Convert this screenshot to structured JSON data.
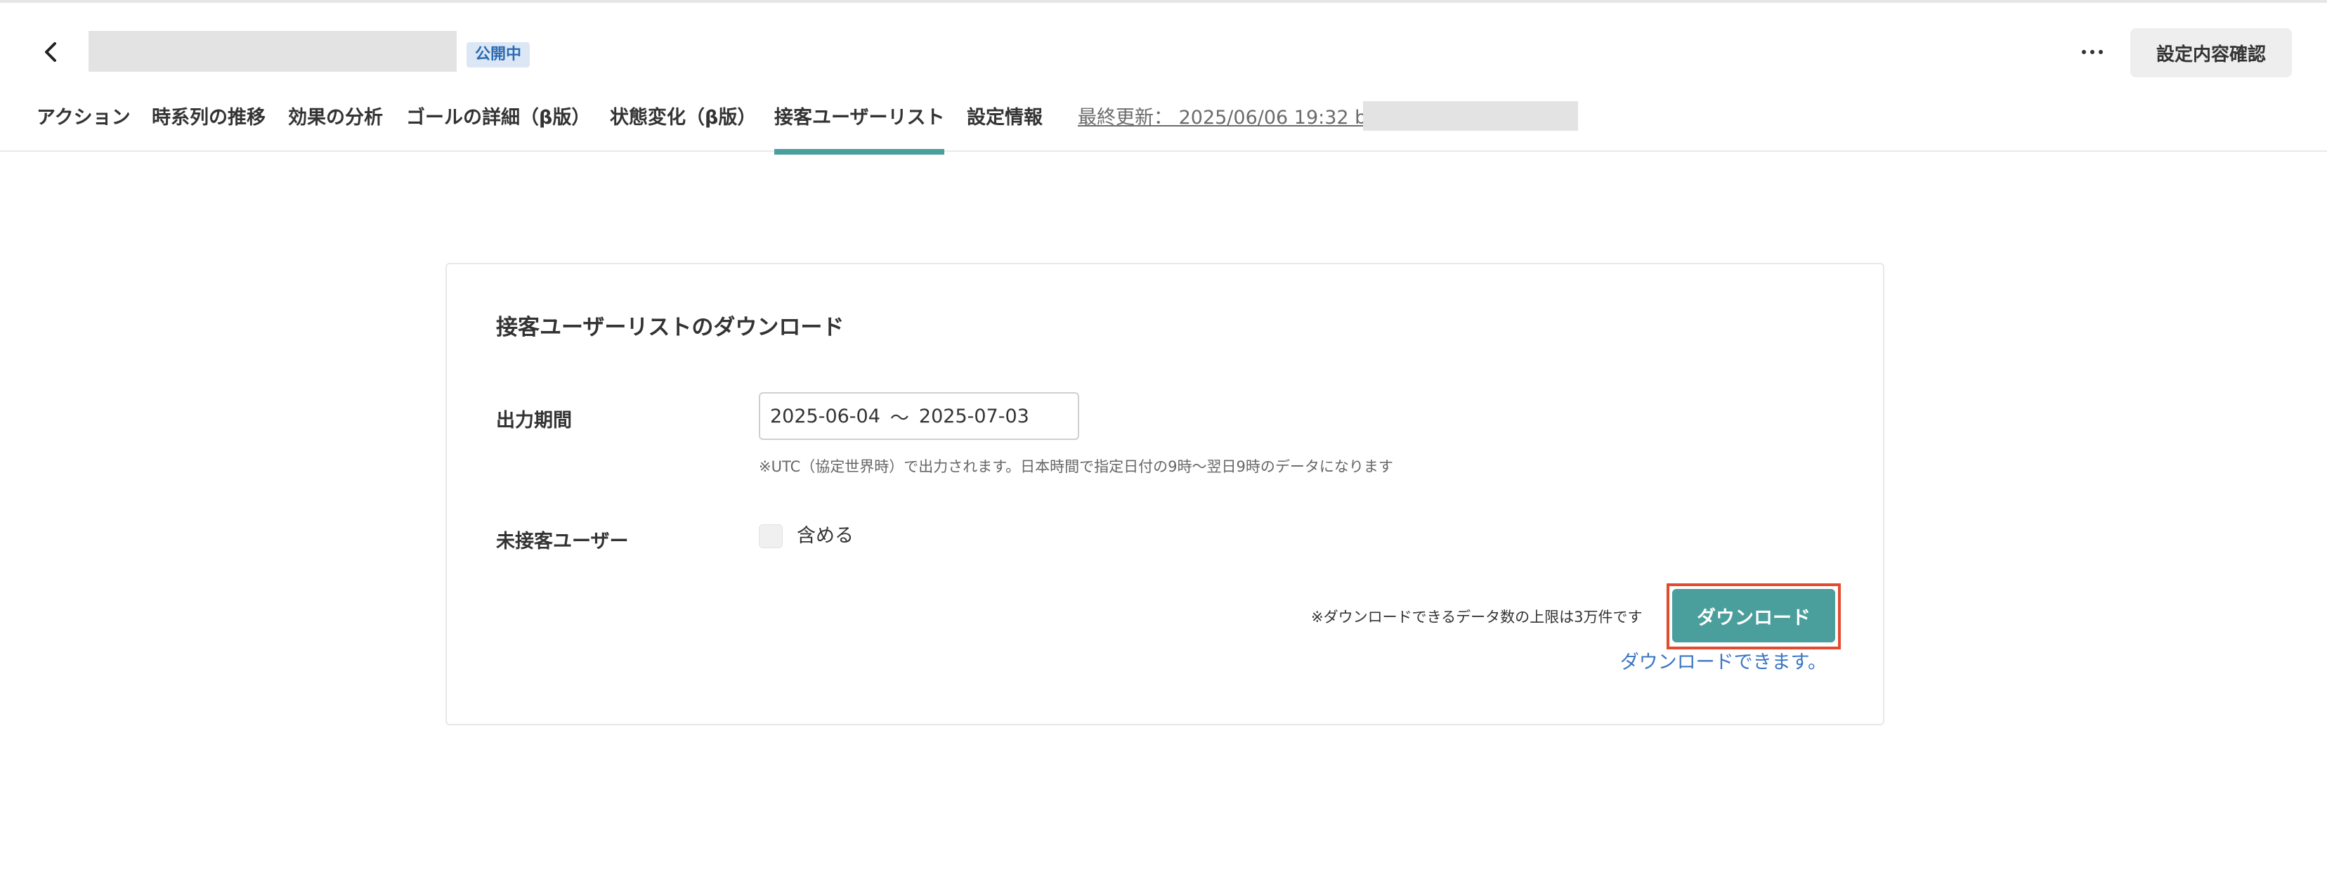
{
  "header": {
    "status_badge": "公開中",
    "confirm_label": "設定内容確認",
    "last_updated": "最終更新： 2025/06/06 19:32 by"
  },
  "tabs": [
    {
      "label": "アクション"
    },
    {
      "label": "時系列の推移"
    },
    {
      "label": "効果の分析"
    },
    {
      "label": "ゴールの詳細（β版）"
    },
    {
      "label": "状態変化（β版）"
    },
    {
      "label": "接客ユーザーリスト",
      "active": true
    },
    {
      "label": "設定情報"
    }
  ],
  "card": {
    "title": "接客ユーザーリストのダウンロード",
    "period_label": "出力期間",
    "date_start": "2025-06-04",
    "date_separator": "〜",
    "date_end": "2025-07-03",
    "tz_note": "※UTC（協定世界時）で出力されます。日本時間で指定日付の9時〜翌日9時のデータになります",
    "unserved_label": "未接客ユーザー",
    "include_label": "含める",
    "limit_note": "※ダウンロードできるデータ数の上限は3万件です",
    "download_label": "ダウンロード",
    "download_status": "ダウンロードできます。"
  },
  "colors": {
    "accent": "#4a9e9c",
    "highlight": "#e34b2f",
    "link": "#3a76c4"
  }
}
